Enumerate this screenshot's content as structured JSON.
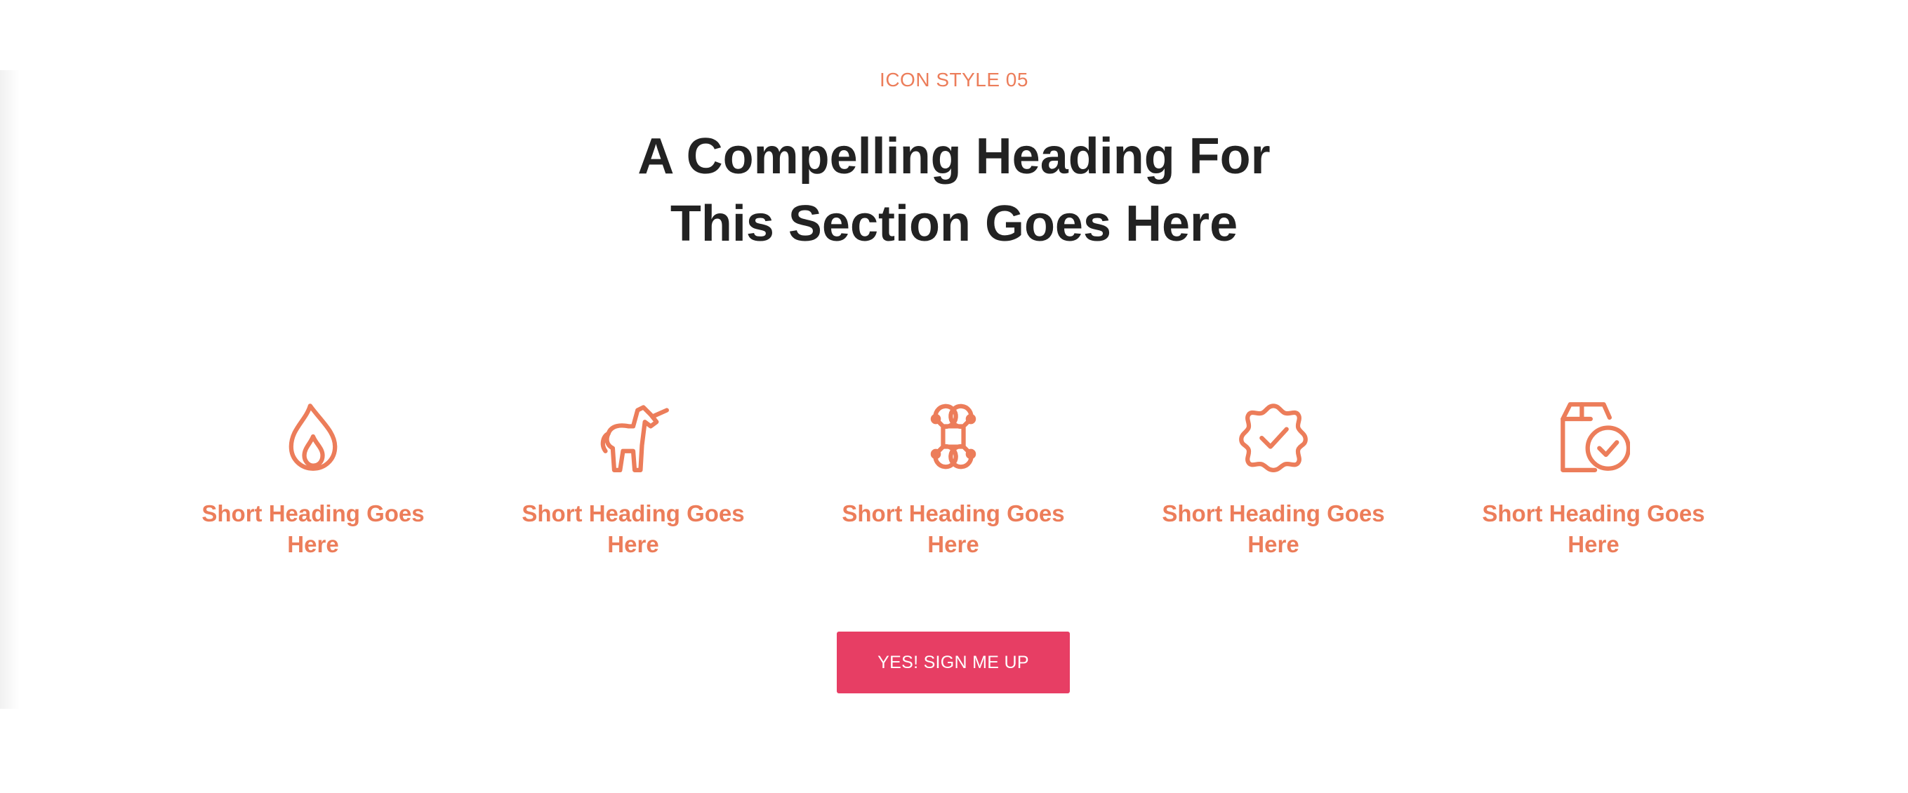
{
  "section": {
    "eyebrow": "ICON STYLE 05",
    "heading_line1": "A Compelling Heading For",
    "heading_line2": "This Section Goes Here"
  },
  "features": [
    {
      "icon": "flame-icon",
      "label": "Short Heading Goes Here"
    },
    {
      "icon": "unicorn-icon",
      "label": "Short Heading Goes Here"
    },
    {
      "icon": "drone-icon",
      "label": "Short Heading Goes Here"
    },
    {
      "icon": "badge-check-icon",
      "label": "Short Heading Goes Here"
    },
    {
      "icon": "package-check-icon",
      "label": "Short Heading Goes Here"
    }
  ],
  "cta": {
    "label": "YES! SIGN ME UP"
  },
  "colors": {
    "accent": "#ec7d5a",
    "button": "#e73e64",
    "heading": "#222222"
  }
}
